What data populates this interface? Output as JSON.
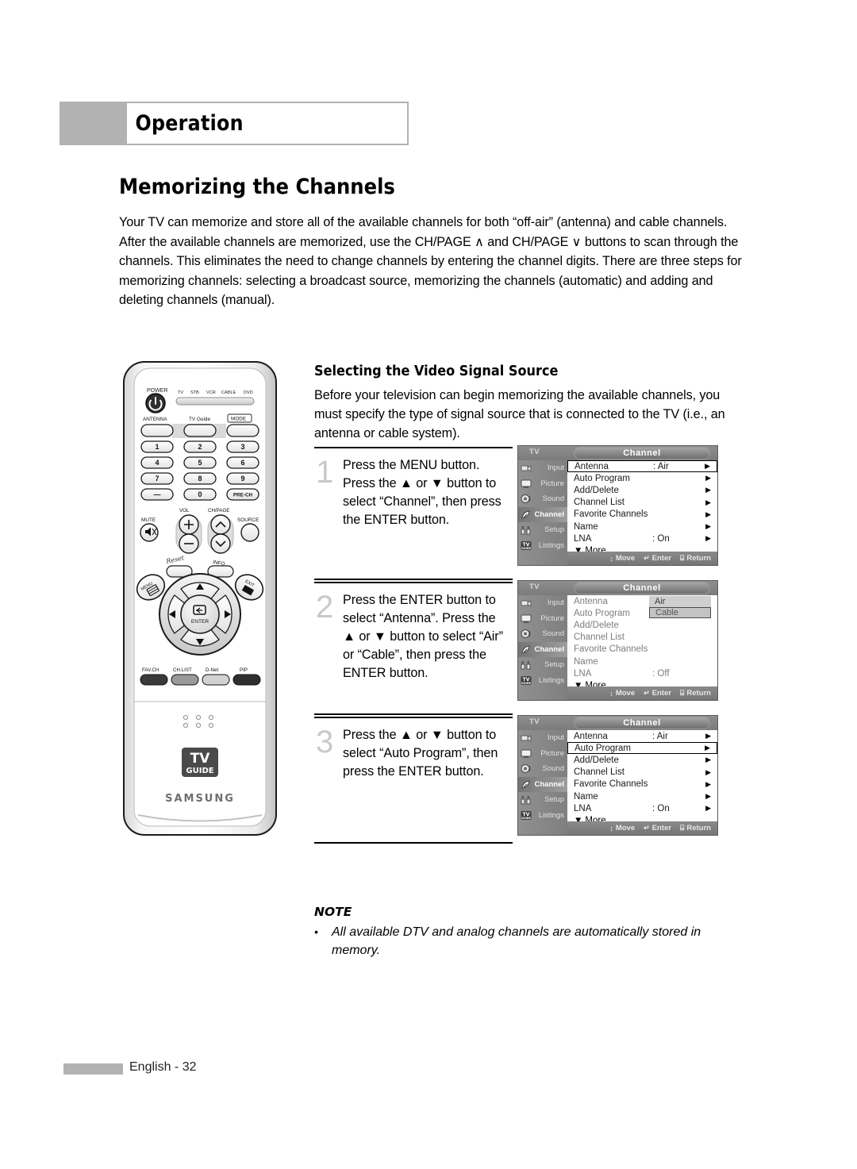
{
  "header": {
    "chapter": "Operation"
  },
  "page": {
    "title": "Memorizing the Channels",
    "intro": "Your TV can memorize and store all of the available channels for both “off-air” (antenna) and cable channels. After the available channels are memorized, use the CH/PAGE ∧ and CH/PAGE ∨ buttons to scan through the channels. This eliminates the need to change channels by entering the channel digits. There are three steps for memorizing channels: selecting a broadcast source, memorizing the channels (automatic) and adding and deleting channels (manual)."
  },
  "subsection": {
    "title": "Selecting the Video Signal Source",
    "body": "Before your television can begin memorizing the available channels, you must specify the type of signal source that is connected to the TV (i.e., an antenna or cable system)."
  },
  "steps": [
    {
      "number": "1",
      "text": "Press the MENU button. Press the ▲ or ▼ button to select “Channel”, then press the ENTER button."
    },
    {
      "number": "2",
      "text": "Press the ENTER button to select “Antenna”. Press the ▲ or ▼ button to select “Air” or “Cable”, then press the ENTER button."
    },
    {
      "number": "3",
      "text": "Press the ▲ or ▼ button to select “Auto Program”, then press the ENTER button."
    }
  ],
  "osd_common": {
    "tv_label": "TV",
    "title": "Channel",
    "sidebar": [
      {
        "label": "Input",
        "icon": "camcorder-icon",
        "active": false
      },
      {
        "label": "Picture",
        "icon": "screen-icon",
        "active": false
      },
      {
        "label": "Sound",
        "icon": "speaker-icon",
        "active": false
      },
      {
        "label": "Channel",
        "icon": "satellite-dish-icon",
        "active": true
      },
      {
        "label": "Setup",
        "icon": "tools-icon",
        "active": false
      },
      {
        "label": "Listings",
        "icon": "tvguide-icon",
        "active": false
      }
    ],
    "footer": [
      {
        "glyph": "↕",
        "label": "Move"
      },
      {
        "glyph": "↵",
        "label": "Enter"
      },
      {
        "glyph": "⌸",
        "label": "Return"
      }
    ],
    "more_label": "More",
    "more_glyph": "▼",
    "arrow_glyph": "▶"
  },
  "osd_screens": [
    {
      "id": "osd-step-1",
      "rows": [
        {
          "label": "Antenna",
          "value": ": Air",
          "arrow": true,
          "selected": true,
          "dim": false
        },
        {
          "label": "Auto Program",
          "value": "",
          "arrow": true,
          "selected": false,
          "dim": false
        },
        {
          "label": "Add/Delete",
          "value": "",
          "arrow": true,
          "selected": false,
          "dim": false
        },
        {
          "label": "Channel List",
          "value": "",
          "arrow": true,
          "selected": false,
          "dim": false
        },
        {
          "label": "Favorite Channels",
          "value": "",
          "arrow": true,
          "selected": false,
          "dim": false
        },
        {
          "label": "Name",
          "value": "",
          "arrow": true,
          "selected": false,
          "dim": false
        },
        {
          "label": "LNA",
          "value": ": On",
          "arrow": true,
          "selected": false,
          "dim": false
        }
      ],
      "dropdown": null
    },
    {
      "id": "osd-step-2",
      "rows": [
        {
          "label": "Antenna",
          "value": "",
          "arrow": false,
          "selected": false,
          "dim": true
        },
        {
          "label": "Auto Program",
          "value": "",
          "arrow": false,
          "selected": false,
          "dim": true
        },
        {
          "label": "Add/Delete",
          "value": "",
          "arrow": false,
          "selected": false,
          "dim": true
        },
        {
          "label": "Channel List",
          "value": "",
          "arrow": false,
          "selected": false,
          "dim": true
        },
        {
          "label": "Favorite Channels",
          "value": "",
          "arrow": false,
          "selected": false,
          "dim": true
        },
        {
          "label": "Name",
          "value": "",
          "arrow": false,
          "selected": false,
          "dim": true
        },
        {
          "label": "LNA",
          "value": ": Off",
          "arrow": false,
          "selected": false,
          "dim": true
        }
      ],
      "dropdown": {
        "options": [
          {
            "label": "Air",
            "current": false
          },
          {
            "label": "Cable",
            "current": true
          }
        ]
      }
    },
    {
      "id": "osd-step-3",
      "rows": [
        {
          "label": "Antenna",
          "value": ": Air",
          "arrow": true,
          "selected": false,
          "dim": false
        },
        {
          "label": "Auto Program",
          "value": "",
          "arrow": true,
          "selected": true,
          "dim": false
        },
        {
          "label": "Add/Delete",
          "value": "",
          "arrow": true,
          "selected": false,
          "dim": false
        },
        {
          "label": "Channel List",
          "value": "",
          "arrow": true,
          "selected": false,
          "dim": false
        },
        {
          "label": "Favorite Channels",
          "value": "",
          "arrow": true,
          "selected": false,
          "dim": false
        },
        {
          "label": "Name",
          "value": "",
          "arrow": true,
          "selected": false,
          "dim": false
        },
        {
          "label": "LNA",
          "value": ": On",
          "arrow": true,
          "selected": false,
          "dim": false
        }
      ],
      "dropdown": null
    }
  ],
  "note": {
    "heading": "NOTE",
    "bullet": "•",
    "text": "All available DTV and analog channels are automatically stored in memory."
  },
  "footer": {
    "page_label": "English - 32"
  },
  "remote": {
    "power_label": "POWER",
    "mode_strip": [
      "TV",
      "STB",
      "VCR",
      "CABLE",
      "DVD"
    ],
    "row_antenna": [
      "ANTENNA",
      "TV Guide",
      "MODE"
    ],
    "keypad": [
      "1",
      "2",
      "3",
      "4",
      "5",
      "6",
      "7",
      "8",
      "9",
      "—",
      "0",
      "PRE-CH"
    ],
    "vol_label": "VOL",
    "chpage_label": "CH/PAGE",
    "mute_label": "MUTE",
    "source_label": "SOURCE",
    "reset_label": "Reset",
    "info_label": "INFO",
    "menu_label": "MENU",
    "exit_label": "EXIT",
    "enter_label": "ENTER",
    "bottom_row": [
      "FAV.CH",
      "CH.LIST",
      "D-Net",
      "PIP"
    ],
    "tvguide_logo_top": "TV",
    "tvguide_logo_bottom": "GUIDE",
    "brand": "SAMSUNG"
  }
}
